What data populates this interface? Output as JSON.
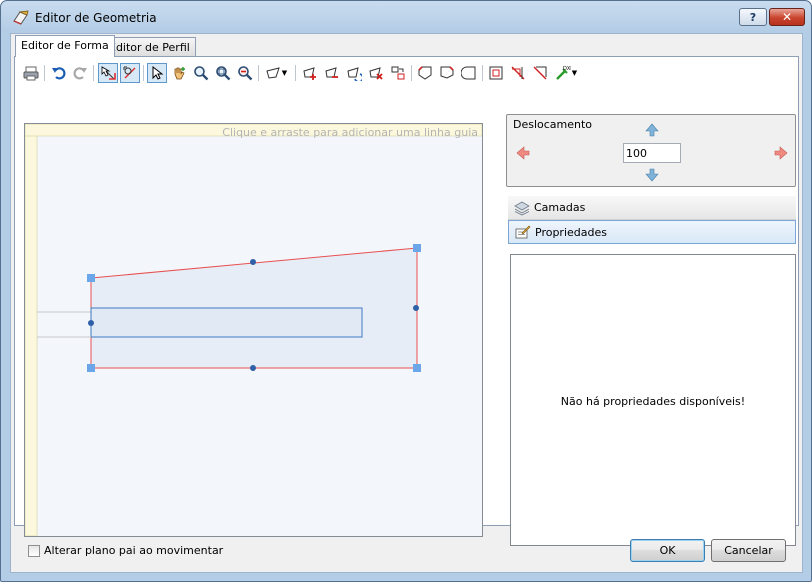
{
  "window": {
    "title": "Editor de Geometria",
    "help_label": "?",
    "close_label": "✕"
  },
  "tabs": [
    {
      "label": "Editor de Forma",
      "active": true
    },
    {
      "label": "Editor de Perfil",
      "active": false
    }
  ],
  "toolbar": {
    "icons": [
      "print-icon",
      "undo-icon",
      "redo-icon",
      "snap-icon",
      "snap-alt-icon",
      "select-arrow-icon",
      "pan-hand-icon",
      "zoom-in-icon",
      "zoom-fit-icon",
      "zoom-out-icon",
      "polygon-dropdown-icon",
      "add-vertex-icon",
      "remove-vertex-icon",
      "rotate-shape-icon",
      "delete-shape-icon",
      "align-shape-icon",
      "chamfer-left-icon",
      "chamfer-right-icon",
      "corner-icon",
      "frame-icon",
      "cut-diagonal-icon",
      "cut-diagonal-alt-icon",
      "dxf-import-icon"
    ]
  },
  "canvas": {
    "guide_hint": "Clique e arraste para adicionar uma linha guia",
    "accent_color": "#e85050",
    "handle_color": "#6aa6e8"
  },
  "offset": {
    "title": "Deslocamento",
    "value": "100"
  },
  "panels": {
    "layers_label": "Camadas",
    "properties_label": "Propriedades",
    "no_properties_message": "Não há propriedades disponíveis!"
  },
  "footer": {
    "checkbox_label": "Alterar plano pai ao movimentar",
    "checkbox_checked": false,
    "ok_label": "OK",
    "cancel_label": "Cancelar"
  }
}
